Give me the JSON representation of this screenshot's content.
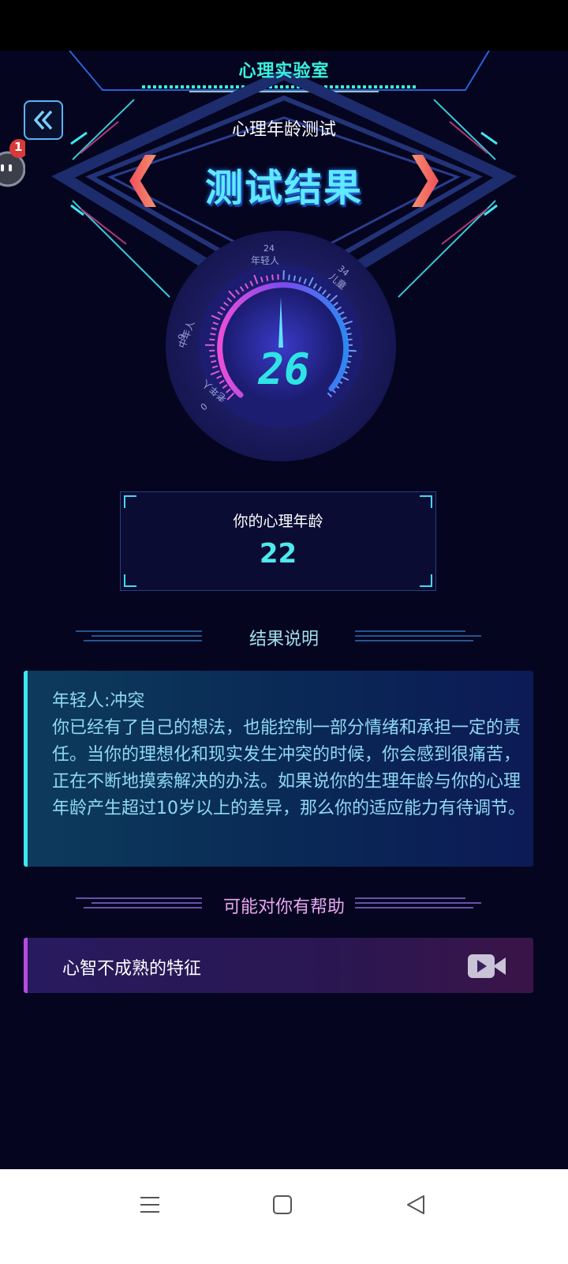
{
  "header": {
    "lab_title": "心理实验室",
    "sub_title": "心理年龄测试",
    "big_title": "测试结果"
  },
  "floating_badge": {
    "count": "1"
  },
  "gauge": {
    "value": "26",
    "ticks": [
      {
        "num": "24",
        "text": "年轻人"
      },
      {
        "num": "34",
        "text": "儿童"
      },
      {
        "num": "9",
        "text": "中年人"
      },
      {
        "num": "0",
        "text": "老年人"
      }
    ]
  },
  "age_box": {
    "label": "你的心理年龄",
    "value": "22"
  },
  "result_section": {
    "title": "结果说明",
    "heading": "年轻人:冲突",
    "body": "你已经有了自己的想法，也能控制一部分情绪和承担一定的责任。当你的理想化和现实发生冲突的时候，你会感到很痛苦，正在不断地摸索解决的办法。如果说你的生理年龄与你的心理年龄产生超过10岁以上的差异，那么你的适应能力有待调节。"
  },
  "help_section": {
    "title": "可能对你有帮助",
    "items": [
      {
        "label": "心智不成熟的特征",
        "icon": "video-icon"
      }
    ]
  },
  "colors": {
    "background": "#05051f",
    "accent_cyan": "#38f2de",
    "accent_purple": "#b74ae0",
    "arrow_red": "#f0505a"
  },
  "navbar": {
    "items": [
      "menu-icon",
      "home-icon",
      "back-icon"
    ]
  }
}
